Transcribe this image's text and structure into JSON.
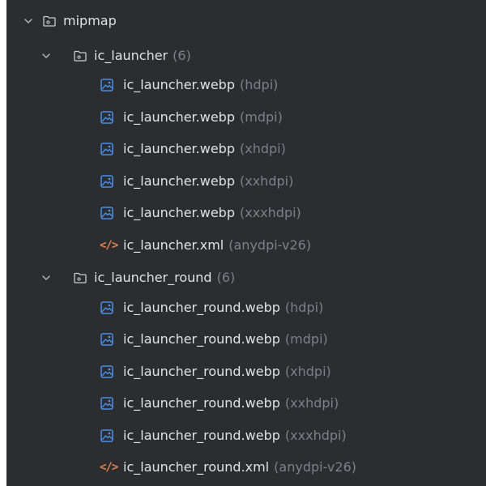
{
  "tree": {
    "root": {
      "label": "mipmap",
      "expanded": true,
      "icon": "folder-icon"
    },
    "groups": [
      {
        "label": "ic_launcher",
        "count": "(6)",
        "expanded": true,
        "icon": "folder-icon",
        "files": [
          {
            "name": "ic_launcher.webp",
            "qualifier": "(hdpi)",
            "icon": "image-file-icon"
          },
          {
            "name": "ic_launcher.webp",
            "qualifier": "(mdpi)",
            "icon": "image-file-icon"
          },
          {
            "name": "ic_launcher.webp",
            "qualifier": "(xhdpi)",
            "icon": "image-file-icon"
          },
          {
            "name": "ic_launcher.webp",
            "qualifier": "(xxhdpi)",
            "icon": "image-file-icon"
          },
          {
            "name": "ic_launcher.webp",
            "qualifier": "(xxxhdpi)",
            "icon": "image-file-icon"
          },
          {
            "name": "ic_launcher.xml",
            "qualifier": "(anydpi-v26)",
            "icon": "xml-file-icon"
          }
        ]
      },
      {
        "label": "ic_launcher_round",
        "count": "(6)",
        "expanded": true,
        "icon": "folder-icon",
        "files": [
          {
            "name": "ic_launcher_round.webp",
            "qualifier": "(hdpi)",
            "icon": "image-file-icon"
          },
          {
            "name": "ic_launcher_round.webp",
            "qualifier": "(mdpi)",
            "icon": "image-file-icon"
          },
          {
            "name": "ic_launcher_round.webp",
            "qualifier": "(xhdpi)",
            "icon": "image-file-icon"
          },
          {
            "name": "ic_launcher_round.webp",
            "qualifier": "(xxhdpi)",
            "icon": "image-file-icon"
          },
          {
            "name": "ic_launcher_round.webp",
            "qualifier": "(xxxhdpi)",
            "icon": "image-file-icon"
          },
          {
            "name": "ic_launcher_round.xml",
            "qualifier": "(anydpi-v26)",
            "icon": "xml-file-icon"
          }
        ]
      }
    ]
  },
  "colors": {
    "background": "#2b2d30",
    "text": "#dfe1e5",
    "muted": "#7d8088",
    "image_icon": "#4a8fe7",
    "xml_icon": "#e2824e"
  }
}
